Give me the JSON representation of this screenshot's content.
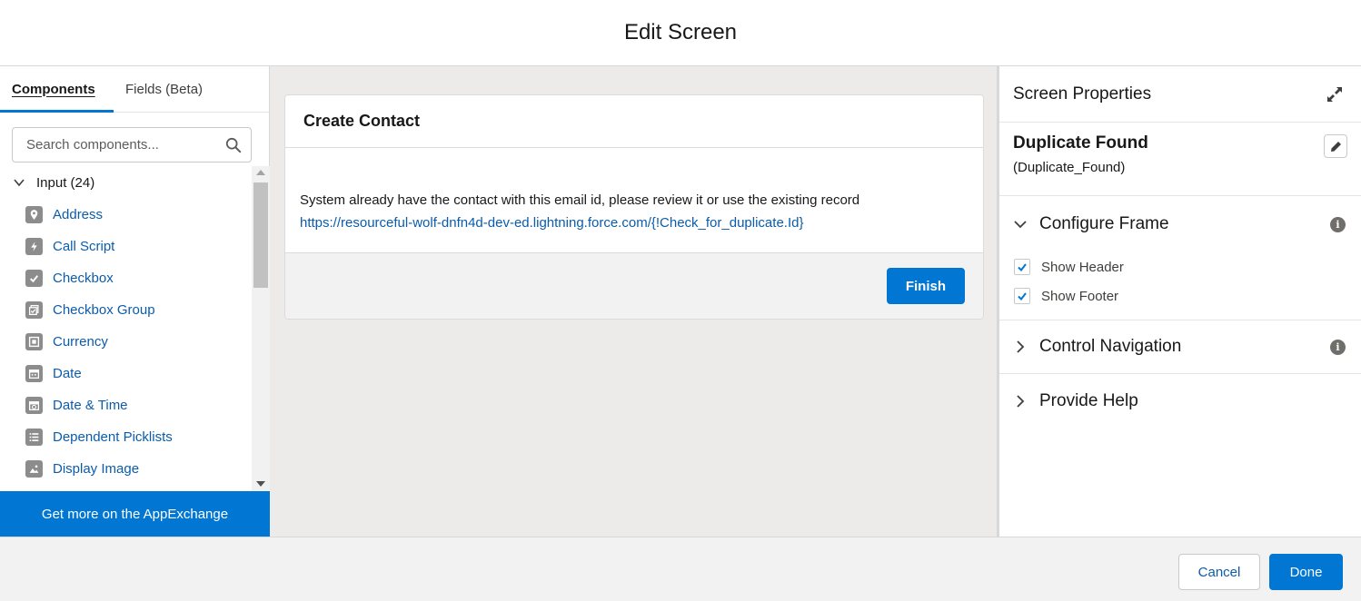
{
  "modal": {
    "title": "Edit Screen"
  },
  "left_panel": {
    "tabs": [
      {
        "label": "Components",
        "active": true
      },
      {
        "label": "Fields (Beta)",
        "active": false
      }
    ],
    "search": {
      "placeholder": "Search components..."
    },
    "section": {
      "label": "Input (24)"
    },
    "components": [
      {
        "label": "Address",
        "icon": "location-icon"
      },
      {
        "label": "Call Script",
        "icon": "lightning-icon"
      },
      {
        "label": "Checkbox",
        "icon": "checkbox-icon"
      },
      {
        "label": "Checkbox Group",
        "icon": "checkbox-group-icon"
      },
      {
        "label": "Currency",
        "icon": "currency-icon"
      },
      {
        "label": "Date",
        "icon": "calendar-icon"
      },
      {
        "label": "Date & Time",
        "icon": "calendar-time-icon"
      },
      {
        "label": "Dependent Picklists",
        "icon": "list-icon"
      },
      {
        "label": "Display Image",
        "icon": "image-icon"
      }
    ],
    "appexchange_label": "Get more on the AppExchange"
  },
  "canvas": {
    "card_title": "Create Contact",
    "message": "System already have the contact with this email id, please review it or use the existing record",
    "link": "https://resourceful-wolf-dnfn4d-dev-ed.lightning.force.com/{!Check_for_duplicate.Id}",
    "finish_label": "Finish"
  },
  "right_panel": {
    "title": "Screen Properties",
    "screen_name": "Duplicate Found",
    "screen_api": "(Duplicate_Found)",
    "sections": {
      "configure_frame": "Configure Frame",
      "control_navigation": "Control Navigation",
      "provide_help": "Provide Help"
    },
    "checkboxes": {
      "show_header": {
        "label": "Show Header",
        "checked": true
      },
      "show_footer": {
        "label": "Show Footer",
        "checked": true
      }
    }
  },
  "footer": {
    "cancel_label": "Cancel",
    "done_label": "Done"
  },
  "colors": {
    "brand": "#0176d3",
    "link": "#0b5cab",
    "canvas_bg": "#ecebea"
  }
}
